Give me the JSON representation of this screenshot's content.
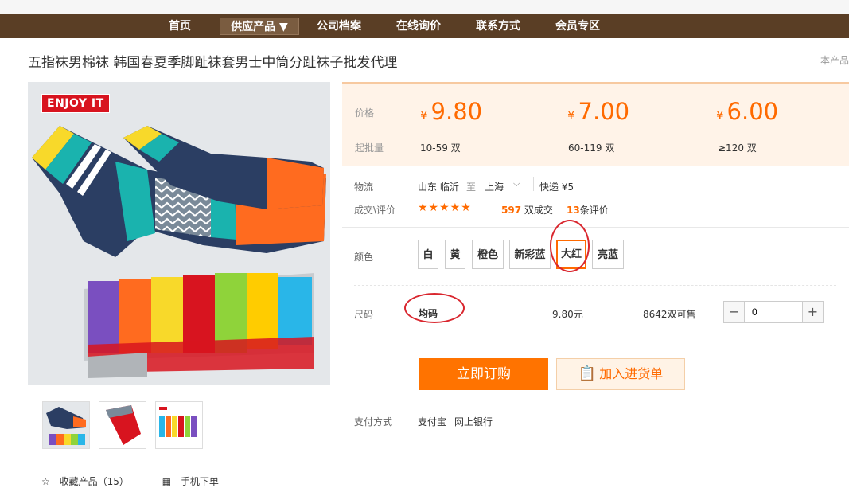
{
  "nav": {
    "items": [
      "首页",
      "供应产品 ▼",
      "公司档案",
      "在线询价",
      "联系方式",
      "会员专区"
    ]
  },
  "product": {
    "title": "五指袜男棉袜 韩国春夏季脚趾袜套男士中筒分趾袜子批发代理",
    "corner_link": "本产品",
    "image_badge": "ENJOY IT"
  },
  "pricing": {
    "price_label": "价格",
    "qty_label": "起批量",
    "currency": "¥",
    "tiers": [
      {
        "price": "9.80",
        "qty": "10-59 双"
      },
      {
        "price": "7.00",
        "qty": "60-119 双"
      },
      {
        "price": "6.00",
        "qty": "≥120 双"
      }
    ]
  },
  "logistics": {
    "label": "物流",
    "from": "山东 临沂",
    "to_word": "至",
    "to": "上海",
    "express": "快递 ¥5"
  },
  "deals": {
    "label": "成交\\评价",
    "stars": "★★★★★",
    "count": "597",
    "count_suffix": "双成交",
    "reviews": "13",
    "reviews_suffix": "条评价"
  },
  "colors": {
    "label": "颜色",
    "options": [
      "白",
      "黄",
      "橙色",
      "新彩蓝",
      "大红",
      "亮蓝"
    ],
    "selected": "大红"
  },
  "size": {
    "label": "尺码",
    "value": "均码",
    "price": "9.80元",
    "stock": "8642双可售",
    "quantity": "0"
  },
  "actions": {
    "buy": "立即订购",
    "cart": "加入进货单"
  },
  "payment": {
    "label": "支付方式",
    "methods": [
      "支付宝",
      "网上银行"
    ]
  },
  "footer_links": {
    "favorite": "收藏产品（15）",
    "mobile": "手机下单"
  },
  "colors_theme": {
    "nav_bg": "#5a3e25",
    "accent": "#ff6a00",
    "highlight_circle": "#d9262e"
  }
}
